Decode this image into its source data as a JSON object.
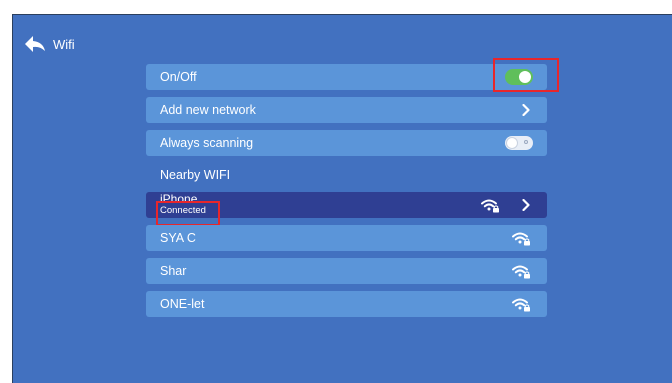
{
  "header": {
    "title": "Wifi"
  },
  "settings": {
    "on_off_label": "On/Off",
    "on_off_state": true,
    "add_network_label": "Add new network",
    "always_scanning_label": "Always scanning",
    "always_scanning_state": false
  },
  "nearby_label": "Nearby WIFI",
  "networks": [
    {
      "name": "iPhone",
      "status": "Connected",
      "selected": true
    },
    {
      "name": "SYA C"
    },
    {
      "name": "Shar"
    },
    {
      "name": "ONE-let"
    }
  ],
  "icons": {
    "back": "back-arrow-icon",
    "chevron": "chevron-right-icon",
    "wifi": "wifi-lock-icon"
  },
  "colors": {
    "background": "#4271c0",
    "row": "#5b95d9",
    "selected_row": "#2f3f93",
    "toggle_on": "#5fbf5b",
    "highlight_box": "#e8262b"
  }
}
